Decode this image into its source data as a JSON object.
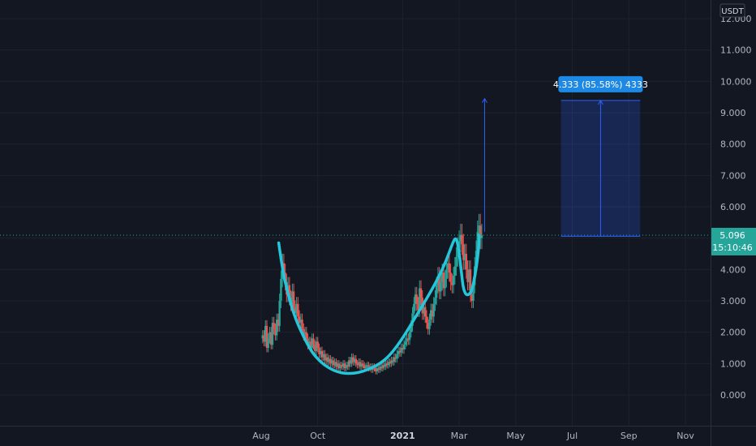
{
  "chart_data": {
    "type": "candlestick",
    "currency_label": "USDT",
    "y_ticks": [
      "12.000",
      "11.000",
      "10.000",
      "9.000",
      "8.000",
      "7.000",
      "6.000",
      "5.000",
      "4.000",
      "3.000",
      "2.000",
      "1.000",
      "0.000"
    ],
    "y_tick_values": [
      12,
      11,
      10,
      9,
      8,
      7,
      6,
      5,
      4,
      3,
      2,
      1,
      0
    ],
    "x_tick_labels": [
      "Aug",
      "Oct",
      "2021",
      "Mar",
      "May",
      "Jul",
      "Sep",
      "Nov"
    ],
    "x_tick_positions": [
      0.0,
      2.0,
      5.0,
      7.0,
      9.0,
      11.0,
      13.0,
      15.0
    ],
    "x_label_bold": [
      "2021"
    ],
    "ylim": [
      -0.9,
      12.0
    ],
    "last_price": "5.096",
    "countdown": "15:10:46",
    "colors": {
      "up": "#26a69a",
      "down": "#ef5350",
      "pattern": "#26c6da",
      "measure": "#2962ff",
      "price_tag": "#26a69a"
    },
    "measure": {
      "label": "4.333 (85.58%) 4333",
      "from_price": 5.06,
      "to_price": 9.39,
      "x_start": 10.6,
      "x_end": 13.4
    },
    "breakout_arrow": {
      "x": 7.9,
      "from": 5.2,
      "to": 9.45
    },
    "closes": [
      [
        0.05,
        1.9
      ],
      [
        0.1,
        1.7
      ],
      [
        0.15,
        2.2
      ],
      [
        0.2,
        1.5
      ],
      [
        0.25,
        1.8
      ],
      [
        0.3,
        2.0
      ],
      [
        0.35,
        1.6
      ],
      [
        0.4,
        2.3
      ],
      [
        0.45,
        2.1
      ],
      [
        0.5,
        1.9
      ],
      [
        0.55,
        2.4
      ],
      [
        0.6,
        2.2
      ],
      [
        0.65,
        3.0
      ],
      [
        0.7,
        3.7
      ],
      [
        0.75,
        4.2
      ],
      [
        0.8,
        3.9
      ],
      [
        0.85,
        3.6
      ],
      [
        0.9,
        3.2
      ],
      [
        0.95,
        3.5
      ],
      [
        1.0,
        3.1
      ],
      [
        1.05,
        2.9
      ],
      [
        1.1,
        3.3
      ],
      [
        1.15,
        2.8
      ],
      [
        1.2,
        2.6
      ],
      [
        1.25,
        2.9
      ],
      [
        1.3,
        2.5
      ],
      [
        1.35,
        2.3
      ],
      [
        1.4,
        2.4
      ],
      [
        1.45,
        2.1
      ],
      [
        1.5,
        1.9
      ],
      [
        1.55,
        2.0
      ],
      [
        1.6,
        1.8
      ],
      [
        1.65,
        1.6
      ],
      [
        1.7,
        1.7
      ],
      [
        1.75,
        1.5
      ],
      [
        1.8,
        1.8
      ],
      [
        1.85,
        1.6
      ],
      [
        1.9,
        1.4
      ],
      [
        1.95,
        1.7
      ],
      [
        2.0,
        1.5
      ],
      [
        2.05,
        1.3
      ],
      [
        2.1,
        1.4
      ],
      [
        2.15,
        1.2
      ],
      [
        2.2,
        1.3
      ],
      [
        2.25,
        1.1
      ],
      [
        2.3,
        1.2
      ],
      [
        2.35,
        1.05
      ],
      [
        2.4,
        1.15
      ],
      [
        2.45,
        1.0
      ],
      [
        2.5,
        1.1
      ],
      [
        2.55,
        0.95
      ],
      [
        2.6,
        1.05
      ],
      [
        2.65,
        0.9
      ],
      [
        2.7,
        1.0
      ],
      [
        2.75,
        0.85
      ],
      [
        2.8,
        0.95
      ],
      [
        2.85,
        0.9
      ],
      [
        2.9,
        1.0
      ],
      [
        2.95,
        0.85
      ],
      [
        3.0,
        0.95
      ],
      [
        3.05,
        0.9
      ],
      [
        3.1,
        1.1
      ],
      [
        3.15,
        1.0
      ],
      [
        3.2,
        1.2
      ],
      [
        3.25,
        1.05
      ],
      [
        3.3,
        1.15
      ],
      [
        3.35,
        1.0
      ],
      [
        3.4,
        0.95
      ],
      [
        3.45,
        1.05
      ],
      [
        3.5,
        0.9
      ],
      [
        3.55,
        1.0
      ],
      [
        3.6,
        0.95
      ],
      [
        3.65,
        0.85
      ],
      [
        3.7,
        0.9
      ],
      [
        3.75,
        0.95
      ],
      [
        3.8,
        0.85
      ],
      [
        3.85,
        0.9
      ],
      [
        3.9,
        0.8
      ],
      [
        3.95,
        0.9
      ],
      [
        4.0,
        0.85
      ],
      [
        4.05,
        0.75
      ],
      [
        4.1,
        0.85
      ],
      [
        4.15,
        0.8
      ],
      [
        4.2,
        0.9
      ],
      [
        4.25,
        0.85
      ],
      [
        4.3,
        0.95
      ],
      [
        4.35,
        0.9
      ],
      [
        4.4,
        1.0
      ],
      [
        4.45,
        0.95
      ],
      [
        4.5,
        1.05
      ],
      [
        4.55,
        1.0
      ],
      [
        4.6,
        1.1
      ],
      [
        4.65,
        1.05
      ],
      [
        4.7,
        1.2
      ],
      [
        4.75,
        1.15
      ],
      [
        4.8,
        1.3
      ],
      [
        4.85,
        1.4
      ],
      [
        4.9,
        1.35
      ],
      [
        4.95,
        1.5
      ],
      [
        5.0,
        1.45
      ],
      [
        5.05,
        1.6
      ],
      [
        5.1,
        1.7
      ],
      [
        5.15,
        1.8
      ],
      [
        5.2,
        1.75
      ],
      [
        5.25,
        2.0
      ],
      [
        5.3,
        2.2
      ],
      [
        5.35,
        2.6
      ],
      [
        5.4,
        2.9
      ],
      [
        5.45,
        3.2
      ],
      [
        5.5,
        2.9
      ],
      [
        5.55,
        2.7
      ],
      [
        5.6,
        3.4
      ],
      [
        5.65,
        3.1
      ],
      [
        5.7,
        2.6
      ],
      [
        5.75,
        2.8
      ],
      [
        5.8,
        2.5
      ],
      [
        5.85,
        2.3
      ],
      [
        5.9,
        2.1
      ],
      [
        5.95,
        2.4
      ],
      [
        6.0,
        2.7
      ],
      [
        6.05,
        2.5
      ],
      [
        6.1,
        2.9
      ],
      [
        6.15,
        3.1
      ],
      [
        6.2,
        3.5
      ],
      [
        6.25,
        3.8
      ],
      [
        6.3,
        3.3
      ],
      [
        6.35,
        3.6
      ],
      [
        6.4,
        3.9
      ],
      [
        6.45,
        3.4
      ],
      [
        6.5,
        3.7
      ],
      [
        6.55,
        4.0
      ],
      [
        6.6,
        4.2
      ],
      [
        6.65,
        3.9
      ],
      [
        6.7,
        3.6
      ],
      [
        6.75,
        3.5
      ],
      [
        6.8,
        3.8
      ],
      [
        6.85,
        4.1
      ],
      [
        6.9,
        4.4
      ],
      [
        6.95,
        4.7
      ],
      [
        7.0,
        4.9
      ],
      [
        7.05,
        5.1
      ],
      [
        7.1,
        4.8
      ],
      [
        7.15,
        4.3
      ],
      [
        7.2,
        4.5
      ],
      [
        7.25,
        4.0
      ],
      [
        7.3,
        3.6
      ],
      [
        7.35,
        4.0
      ],
      [
        7.4,
        3.2
      ],
      [
        7.45,
        3.0
      ],
      [
        7.5,
        3.5
      ],
      [
        7.55,
        4.1
      ],
      [
        7.6,
        4.6
      ],
      [
        7.65,
        5.2
      ],
      [
        7.7,
        5.4
      ],
      [
        7.75,
        5.0
      ],
      [
        7.8,
        5.1
      ]
    ],
    "pattern_curve": [
      [
        0.62,
        4.85
      ],
      [
        0.75,
        4.0
      ],
      [
        0.95,
        3.2
      ],
      [
        1.2,
        2.45
      ],
      [
        1.5,
        1.85
      ],
      [
        1.8,
        1.35
      ],
      [
        2.1,
        1.05
      ],
      [
        2.4,
        0.85
      ],
      [
        2.7,
        0.73
      ],
      [
        3.0,
        0.68
      ],
      [
        3.3,
        0.69
      ],
      [
        3.6,
        0.75
      ],
      [
        3.9,
        0.86
      ],
      [
        4.2,
        1.0
      ],
      [
        4.5,
        1.22
      ],
      [
        4.8,
        1.55
      ],
      [
        5.1,
        1.95
      ],
      [
        5.4,
        2.4
      ],
      [
        5.7,
        2.85
      ],
      [
        6.0,
        3.3
      ],
      [
        6.3,
        3.8
      ],
      [
        6.55,
        4.3
      ],
      [
        6.75,
        4.8
      ],
      [
        6.88,
        5.05
      ],
      [
        6.98,
        4.7
      ],
      [
        7.08,
        3.9
      ],
      [
        7.15,
        3.35
      ],
      [
        7.28,
        3.15
      ],
      [
        7.45,
        3.3
      ],
      [
        7.6,
        4.0
      ],
      [
        7.68,
        4.6
      ],
      [
        7.72,
        5.05
      ],
      [
        7.68,
        5.1
      ]
    ]
  }
}
